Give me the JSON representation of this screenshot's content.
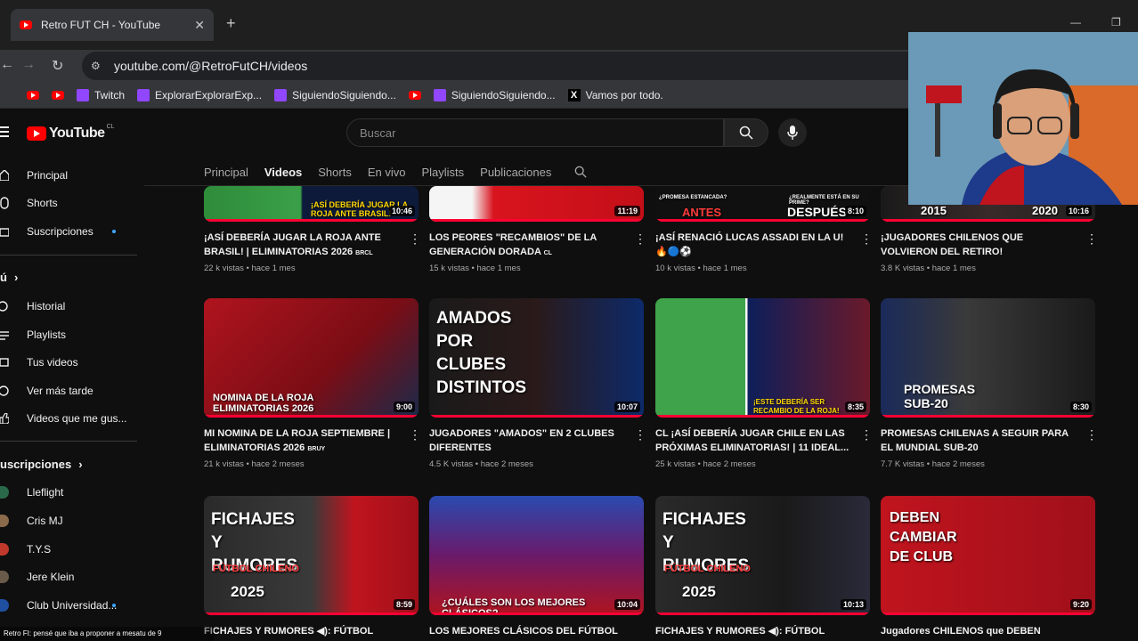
{
  "browser": {
    "tab_title": "Retro FUT CH - YouTube",
    "tab_close": "✕",
    "new_tab": "+",
    "url": "youtube.com/@RetroFutCH/videos",
    "bookmarks": [
      {
        "icon": "youtube-icon",
        "label": ""
      },
      {
        "icon": "youtube-icon",
        "label": ""
      },
      {
        "icon": "twitch-icon",
        "label": "Twitch"
      },
      {
        "icon": "twitch-icon",
        "label": "ExplorarExplorarExp..."
      },
      {
        "icon": "twitch-icon",
        "label": "SiguiendoSiguiendo..."
      },
      {
        "icon": "youtube-icon",
        "label": ""
      },
      {
        "icon": "twitch-icon",
        "label": "SiguiendoSiguiendo..."
      },
      {
        "icon": "x-icon",
        "label": "Vamos por todo."
      }
    ]
  },
  "youtube": {
    "logo_text": "YouTube",
    "country": "CL",
    "search_placeholder": "Buscar"
  },
  "sidebar": {
    "items": [
      {
        "icon": "home-icon",
        "label": "Principal"
      },
      {
        "icon": "shorts-icon",
        "label": "Shorts"
      },
      {
        "icon": "subscriptions-icon",
        "label": "Suscripciones"
      }
    ],
    "you_label": "ú",
    "you_items": [
      {
        "icon": "history-icon",
        "label": "Historial"
      },
      {
        "icon": "playlists-icon",
        "label": "Playlists"
      },
      {
        "icon": "your-videos-icon",
        "label": "Tus videos"
      },
      {
        "icon": "watch-later-icon",
        "label": "Ver más tarde"
      },
      {
        "icon": "liked-videos-icon",
        "label": "Videos que me gus..."
      }
    ],
    "subs_label": "uscripciones",
    "subs": [
      {
        "label": "Lleflight",
        "color": "#2a6a4a"
      },
      {
        "label": "Cris MJ",
        "color": "#8a6a4a"
      },
      {
        "label": "T.Y.S",
        "color": "#c0392b"
      },
      {
        "label": "Jere Klein",
        "color": "#6a5a4a"
      },
      {
        "label": "Club Universidad...",
        "color": "#1e4fa0"
      }
    ]
  },
  "channel_tabs": [
    "Principal",
    "Videos",
    "Shorts",
    "En vivo",
    "Playlists",
    "Publicaciones"
  ],
  "active_tab": "Videos",
  "videos": [
    {
      "title": "¡ASÍ DEBERÍA JUGAR LA ROJA ANTE BRASIL! | ELIMINATORIAS 2026",
      "suffix": "BRCL",
      "meta": "22 k vistas • hace 1 mes",
      "duration": "10:46",
      "overlay": "¡ASÍ DEBERÍA JUGAR LA ROJA ANTE BRASIL!"
    },
    {
      "title": "LOS PEORES \"RECAMBIOS\" DE LA GENERACIÓN DORADA",
      "suffix": "CL",
      "meta": "15 k vistas • hace 1 mes",
      "duration": "11:19",
      "overlay": ""
    },
    {
      "title": "¡ASÍ RENACIÓ LUCAS ASSADI EN LA U! 🔥🔵⚽",
      "suffix": "",
      "meta": "10 k vistas • hace 1 mes",
      "duration": "8:10",
      "overlay": "ANTES",
      "overlay2": "DESPUÉS",
      "tag1": "¿PROMESA ESTANCADA?",
      "tag2": "¿REALMENTE ESTÁ EN SU PRIME?"
    },
    {
      "title": "¡JUGADORES CHILENOS QUE VOLVIERON DEL RETIRO!",
      "suffix": "",
      "meta": "3.8 K vistas • hace 1 mes",
      "duration": "10:16",
      "overlay": "2015",
      "overlay2": "2020"
    },
    {
      "title": "MI NOMINA DE LA ROJA SEPTIEMBRE | ELIMINATORIAS 2026",
      "suffix": "BRUY",
      "meta": "21 k vistas • hace 2 meses",
      "duration": "9:00",
      "overlay": "NOMINA DE LA ROJA ELIMINATORIAS 2026"
    },
    {
      "title": "JUGADORES \"AMADOS\" EN 2 CLUBES DIFERENTES",
      "suffix": "",
      "meta": "4.5 K vistas • hace 2 meses",
      "duration": "10:07",
      "overlay": "AMADOS POR CLUBES DISTINTOS"
    },
    {
      "title": "CL ¡ASÍ DEBERÍA JUGAR CHILE EN LAS PRÓXIMAS ELIMINATORIAS! | 11 IDEAL...",
      "suffix": "",
      "meta": "25 k vistas • hace 2 meses",
      "duration": "8:35",
      "overlay": "¡ESTE DEBERÍA SER RECAMBIO DE LA ROJA!"
    },
    {
      "title": "PROMESAS CHILENAS A SEGUIR PARA EL MUNDIAL SUB-20",
      "suffix": "",
      "meta": "7.7 K vistas • hace 2 meses",
      "duration": "8:30",
      "overlay": "PROMESAS SUB-20"
    },
    {
      "title": "FICHAJES Y RUMORES ◀): FÚTBOL",
      "suffix": "",
      "meta": "",
      "duration": "8:59",
      "overlay": "FICHAJES Y RUMORES",
      "overlay2": "FÚTBOL CHILENO",
      "overlay3": "2025"
    },
    {
      "title": "LOS MEJORES CLÁSICOS DEL FÚTBOL",
      "suffix": "",
      "meta": "",
      "duration": "10:04",
      "overlay": "¿CUÁLES SON LOS MEJORES CLÁSICOS?"
    },
    {
      "title": "FICHAJES Y RUMORES ◀): FÚTBOL",
      "suffix": "",
      "meta": "",
      "duration": "10:13",
      "overlay": "FICHAJES Y RUMORES",
      "overlay2": "FÚTBOL CHILENO",
      "overlay3": "2025"
    },
    {
      "title": "Jugadores CHILENOS que DEBEN cambiar",
      "suffix": "",
      "meta": "",
      "duration": "9:20",
      "overlay": "DEBEN CAMBIAR DE CLUB"
    }
  ],
  "chat_overlay": "Retro FI: pensé que iba a proponer a mesatu de 9"
}
